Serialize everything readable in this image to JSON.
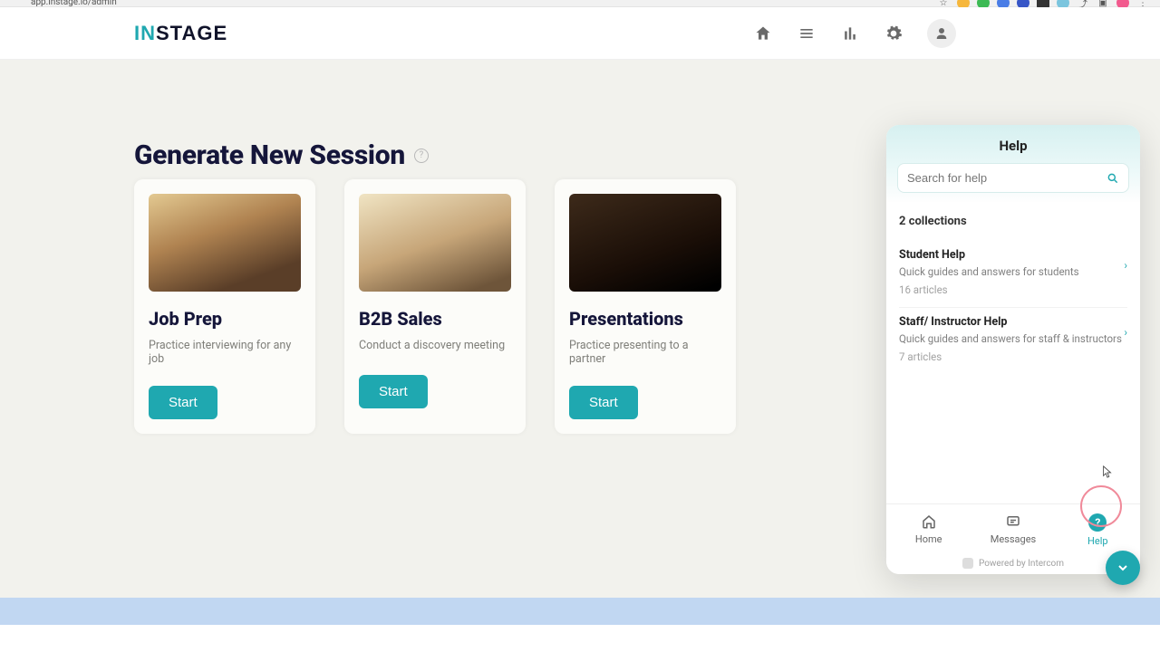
{
  "browser": {
    "url": "app.instage.io/admin"
  },
  "logo": {
    "part1": "IN",
    "part2": "STAGE"
  },
  "nav": {
    "icons": [
      "home-icon",
      "list-icon",
      "chart-icon",
      "gear-icon",
      "user-icon"
    ]
  },
  "main": {
    "title": "Generate New Session",
    "cards": [
      {
        "title": "Job Prep",
        "desc": "Practice interviewing for any job",
        "cta": "Start"
      },
      {
        "title": "B2B Sales",
        "desc": "Conduct a discovery meeting",
        "cta": "Start"
      },
      {
        "title": "Presentations",
        "desc": "Practice presenting to a partner",
        "cta": "Start"
      }
    ]
  },
  "help": {
    "title": "Help",
    "search_placeholder": "Search for help",
    "collections_label": "2 collections",
    "collections": [
      {
        "title": "Student Help",
        "desc": "Quick guides and answers for students",
        "count": "16 articles"
      },
      {
        "title": "Staff/ Instructor Help",
        "desc": "Quick guides and answers for staff & instructors",
        "count": "7 articles"
      }
    ],
    "tabs": {
      "home": "Home",
      "messages": "Messages",
      "help": "Help",
      "help_badge": "?"
    },
    "powered": "Powered by Intercom"
  },
  "colors": {
    "accent": "#1fa8b0"
  }
}
